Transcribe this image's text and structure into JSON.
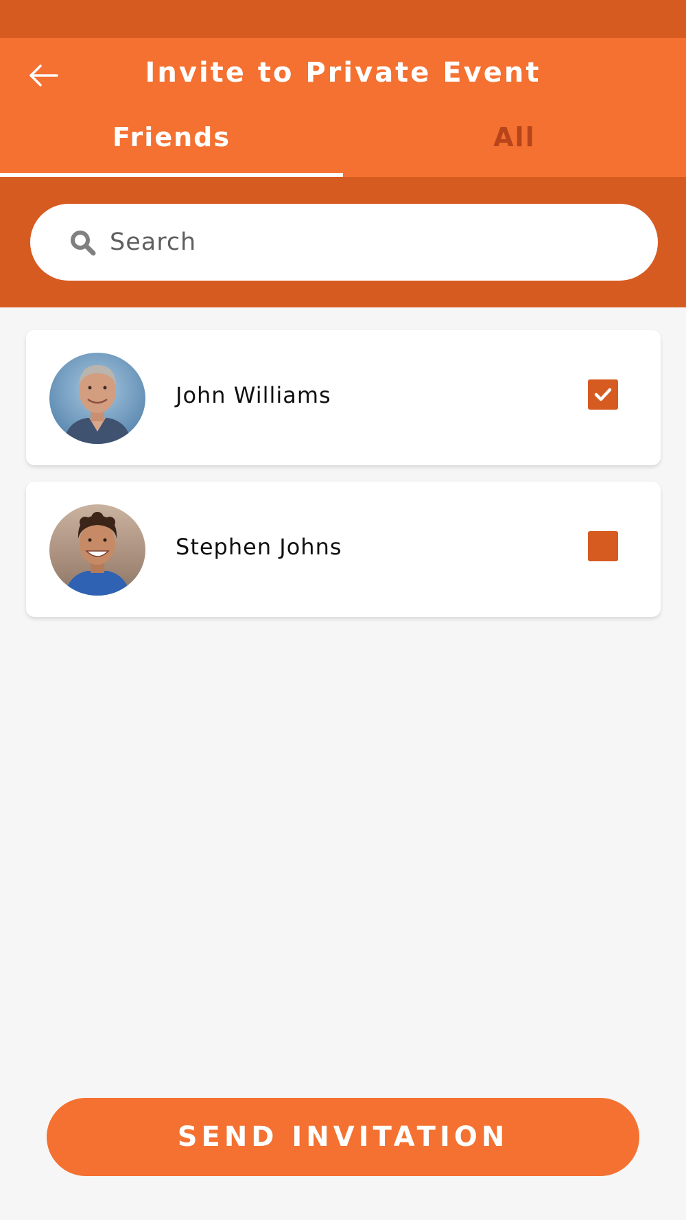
{
  "header": {
    "title": "Invite to Private Event",
    "back_icon": "arrow-left-icon"
  },
  "tabs": [
    {
      "label": "Friends",
      "active": true
    },
    {
      "label": "All",
      "active": false
    }
  ],
  "search": {
    "placeholder": "Search",
    "value": "",
    "icon": "search-icon"
  },
  "contacts": [
    {
      "name": "John Williams",
      "selected": true
    },
    {
      "name": "Stephen Johns",
      "selected": false
    }
  ],
  "send_button": {
    "label": "SEND INVITATION"
  },
  "colors": {
    "primary": "#f47131",
    "primary_dark": "#d65b21",
    "inactive_tab": "#b8441b",
    "background": "#f6f6f6"
  }
}
